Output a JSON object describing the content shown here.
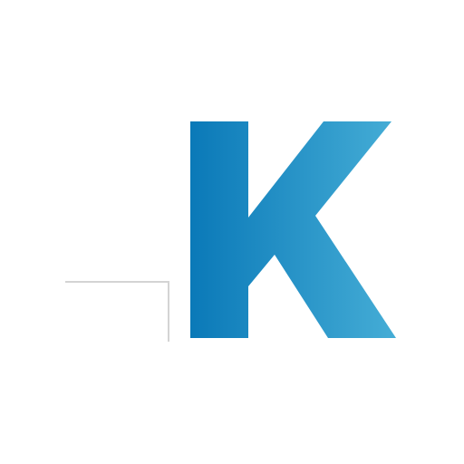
{
  "logo": {
    "letter": "K",
    "colors": {
      "gradient_start": "#0a79b8",
      "gradient_end": "#45add6",
      "frame_line": "#d4d4d4",
      "background": "#ffffff"
    }
  }
}
